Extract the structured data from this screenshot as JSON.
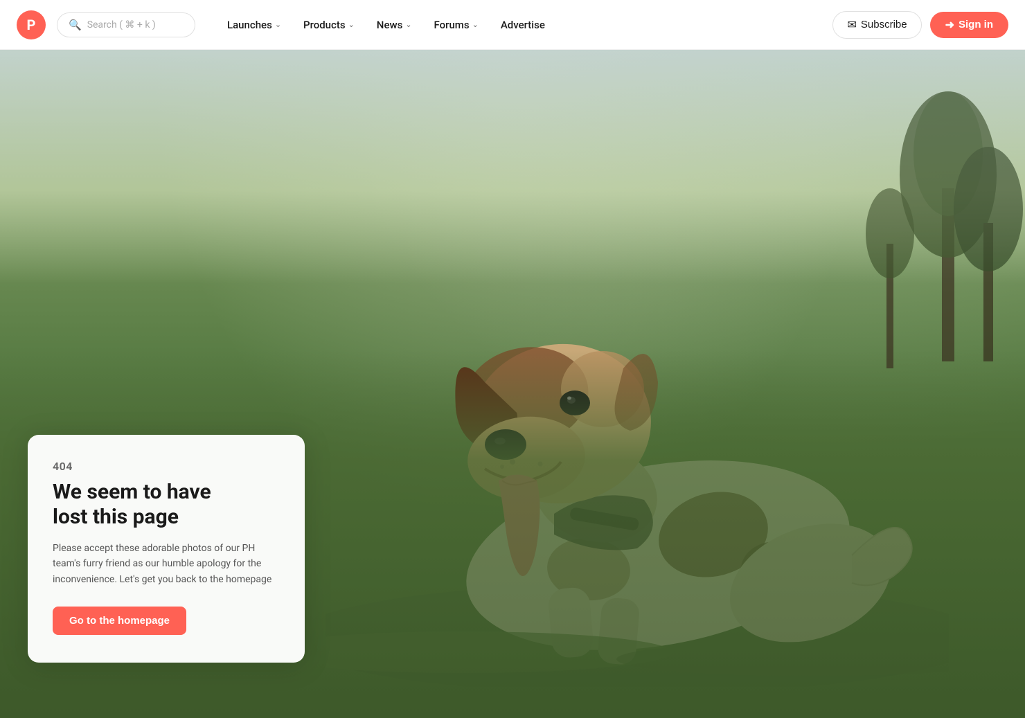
{
  "site": {
    "logo_letter": "P",
    "logo_color": "#ff6154"
  },
  "navbar": {
    "search_placeholder": "Search ( ⌘ + k )",
    "items": [
      {
        "label": "Launches",
        "has_dropdown": true
      },
      {
        "label": "Products",
        "has_dropdown": true
      },
      {
        "label": "News",
        "has_dropdown": true
      },
      {
        "label": "Forums",
        "has_dropdown": true
      },
      {
        "label": "Advertise",
        "has_dropdown": false
      }
    ],
    "subscribe_label": "Subscribe",
    "signin_label": "Sign in"
  },
  "error_page": {
    "code": "404",
    "title_line1": "We seem to have",
    "title_line2": "lost this page",
    "description": "Please accept these adorable photos of our PH team's furry friend as our humble apology for the inconvenience. Let's get you back to the homepage",
    "cta_label": "Go to the homepage"
  },
  "icons": {
    "search": "⌕",
    "chevron": "›",
    "subscribe_icon": "✉",
    "signin_icon": "→"
  }
}
